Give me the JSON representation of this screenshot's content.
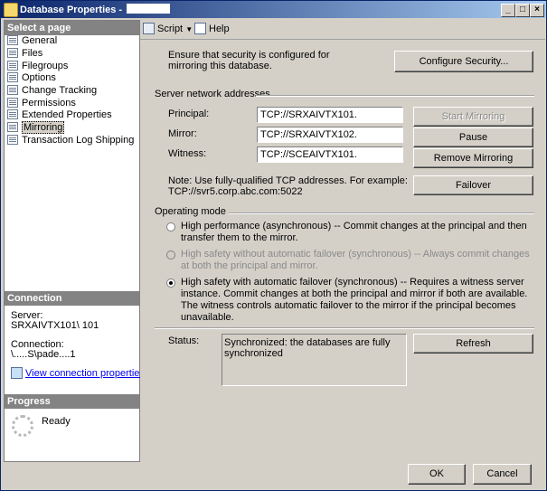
{
  "window": {
    "title": "Database Properties - ",
    "controls": [
      "_",
      "□",
      "×"
    ]
  },
  "left": {
    "select_page_header": "Select a page",
    "pages": [
      "General",
      "Files",
      "Filegroups",
      "Options",
      "Change Tracking",
      "Permissions",
      "Extended Properties",
      "Mirroring",
      "Transaction Log Shipping"
    ],
    "selected_page": "Mirroring",
    "connection_header": "Connection",
    "server_label": "Server:",
    "server_value": "SRXAIVTX101\\            101",
    "connection_label": "Connection:",
    "connection_value": "\\.....S\\pade....1",
    "view_connection_link": "View connection properties",
    "progress_header": "Progress",
    "progress_status": "Ready"
  },
  "toolbar": {
    "script_label": "Script",
    "help_label": "Help"
  },
  "security": {
    "note": "Ensure that security is configured for mirroring this database.",
    "configure_button": "Configure Security..."
  },
  "addresses": {
    "group_label": "Server network addresses",
    "principal_label": "Principal:",
    "principal_value": "TCP://SRXAIVTX101.",
    "mirror_label": "Mirror:",
    "mirror_value": "TCP://SRXAIVTX102.",
    "witness_label": "Witness:",
    "witness_value": "TCP://SCEAIVTX101.",
    "note_line1": "Note: Use fully-qualified TCP addresses. For example:",
    "note_line2": "TCP://svr5.corp.abc.com:5022",
    "start_mirroring_button": "Start Mirroring",
    "pause_button": "Pause",
    "remove_mirroring_button": "Remove Mirroring",
    "failover_button": "Failover"
  },
  "operating_mode": {
    "group_label": "Operating mode",
    "options": [
      {
        "text": "High performance (asynchronous) -- Commit changes at the principal and then transfer them to the mirror.",
        "checked": false,
        "enabled": true
      },
      {
        "text": "High safety without automatic failover (synchronous) -- Always commit changes at both the principal and mirror.",
        "checked": false,
        "enabled": false
      },
      {
        "text": "High safety with automatic failover (synchronous) -- Requires a witness server instance. Commit changes at both the principal and mirror if both are available. The witness controls automatic failover to the mirror if the principal becomes unavailable.",
        "checked": true,
        "enabled": true
      }
    ]
  },
  "status": {
    "label": "Status:",
    "text": "Synchronized: the databases are fully synchronized",
    "refresh_button": "Refresh"
  },
  "footer": {
    "ok_button": "OK",
    "cancel_button": "Cancel"
  }
}
